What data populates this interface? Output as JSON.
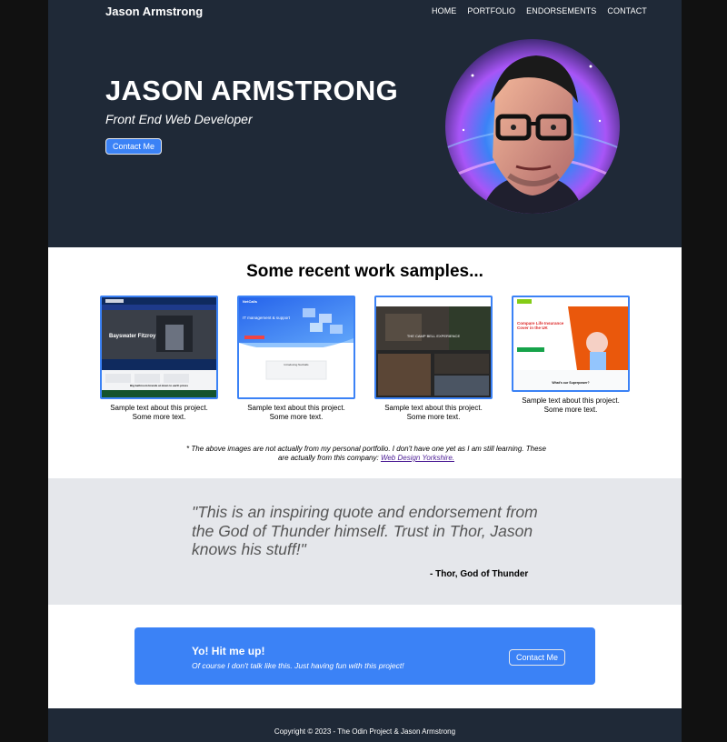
{
  "header": {
    "brand": "Jason Armstrong",
    "nav": [
      "HOME",
      "PORTFOLIO",
      "ENDORSEMENTS",
      "CONTACT"
    ]
  },
  "hero": {
    "title": "JASON ARMSTRONG",
    "subtitle": "Front End Web Developer",
    "button_label": "Contact Me"
  },
  "samples": {
    "title": "Some recent work samples...",
    "cards": [
      {
        "text": "Sample text about this project. Some more text."
      },
      {
        "text": "Sample text about this project. Some more text."
      },
      {
        "text": "Sample text about this project. Some more text."
      },
      {
        "text": "Sample text about this project. Some more text."
      }
    ],
    "thumbnails": [
      {
        "headline": "Bayswater Fitzroy",
        "caption": "Big bathroom brands at down to earth prices"
      },
      {
        "logo": "NetCalls",
        "headline": "IT management & support",
        "caption": "Introducing NetCalls"
      },
      {
        "headline": "THE CAMP BELL EXPERIENCE"
      },
      {
        "headline": "Compare Life Insurance Cover in the UK",
        "caption": "What's our Superpower?"
      }
    ],
    "disclaimer": "* The above images are not actually from my personal portfolio. I don't have one yet as I am still learning. These are actually from this company:",
    "disclaimer_link": "Web Design Yorkshire."
  },
  "quote": {
    "text": "\"This is an inspiring quote and endorsement from the God of Thunder himself. Trust in Thor, Jason knows his stuff!\"",
    "author": "- Thor, God of Thunder"
  },
  "cta": {
    "title": "Yo! Hit me up!",
    "subtitle": "Of course I don't talk like this. Just having fun with this project!",
    "button_label": "Contact Me"
  },
  "footer": {
    "text": "Copyright © 2023 - The Odin Project & Jason Armstrong"
  },
  "colors": {
    "dark": "#1f2937",
    "accent": "#3b82f6",
    "quote_band": "#e5e7eb"
  }
}
